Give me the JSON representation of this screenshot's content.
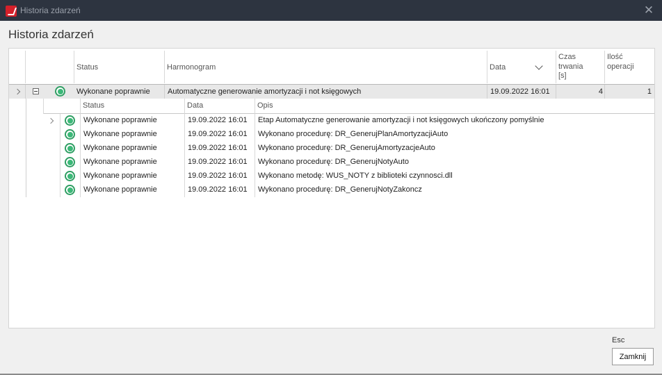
{
  "window": {
    "title": "Historia zdarzeń",
    "close_glyph": "✕"
  },
  "dialog": {
    "heading": "Historia zdarzeń"
  },
  "grid": {
    "columns": {
      "status": "Status",
      "harmonogram": "Harmonogram",
      "data": "Data",
      "duration": "Czas\ntrwania\n[s]",
      "ops": "Ilość\noperacji"
    },
    "master_row": {
      "status_icon": "status-ok-icon",
      "status": "Wykonane poprawnie",
      "harmonogram": "Automatyczne generowanie amortyzacji i not księgowych",
      "data": "19.09.2022 16:01",
      "duration": "4",
      "ops": "1"
    },
    "detail": {
      "columns": {
        "status": "Status",
        "data": "Data",
        "opis": "Opis"
      },
      "rows": [
        {
          "status": "Wykonane poprawnie",
          "data": "19.09.2022 16:01",
          "opis": "Etap Automatyczne generowanie amortyzacji i not księgowych ukończony pomyślnie"
        },
        {
          "status": "Wykonane poprawnie",
          "data": "19.09.2022 16:01",
          "opis": "Wykonano procedurę: DR_GenerujPlanAmortyzacjiAuto"
        },
        {
          "status": "Wykonane poprawnie",
          "data": "19.09.2022 16:01",
          "opis": "Wykonano procedurę: DR_GenerujAmortyzacjeAuto"
        },
        {
          "status": "Wykonane poprawnie",
          "data": "19.09.2022 16:01",
          "opis": "Wykonano procedurę: DR_GenerujNotyAuto"
        },
        {
          "status": "Wykonane poprawnie",
          "data": "19.09.2022 16:01",
          "opis": "Wykonano metodę: WUS_NOTY z biblioteki czynnosci.dll"
        },
        {
          "status": "Wykonane poprawnie",
          "data": "19.09.2022 16:01",
          "opis": "Wykonano procedurę: DR_GenerujNotyZakoncz"
        }
      ]
    }
  },
  "footer": {
    "shortcut": "Esc",
    "close_button": "Zamknij"
  },
  "colors": {
    "titlebar": "#2d3440",
    "status_ok": "#3cb878",
    "master_row_bg": "#e8e8e8"
  }
}
